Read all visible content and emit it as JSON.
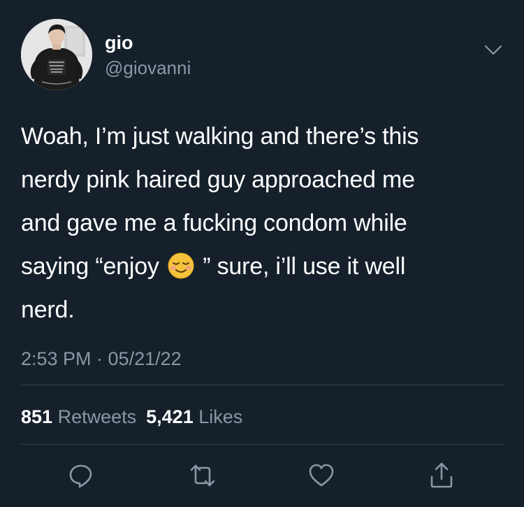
{
  "user": {
    "display_name": "gio",
    "handle": "@giovanni"
  },
  "tweet": {
    "lines": [
      "Woah, I’m just walking and there’s this",
      "nerdy pink haired guy approached me",
      "and gave me a fucking condom while"
    ],
    "line4_before_emoji": "saying “enjoy ",
    "emoji": "smiling-face-emoji",
    "line4_after_emoji": " ” sure, i’ll use it well",
    "line5": "nerd."
  },
  "meta": {
    "timestamp": "2:53 PM · 05/21/22"
  },
  "stats": {
    "retweets_count": "851",
    "retweets_label": "Retweets",
    "likes_count": "5,421",
    "likes_label": "Likes"
  },
  "actions": [
    "reply-icon",
    "retweet-icon",
    "like-icon",
    "share-icon"
  ],
  "colors": {
    "background": "#15202b",
    "primary_text": "#ffffff",
    "secondary_text": "#8899a6",
    "divider": "#38444d"
  }
}
